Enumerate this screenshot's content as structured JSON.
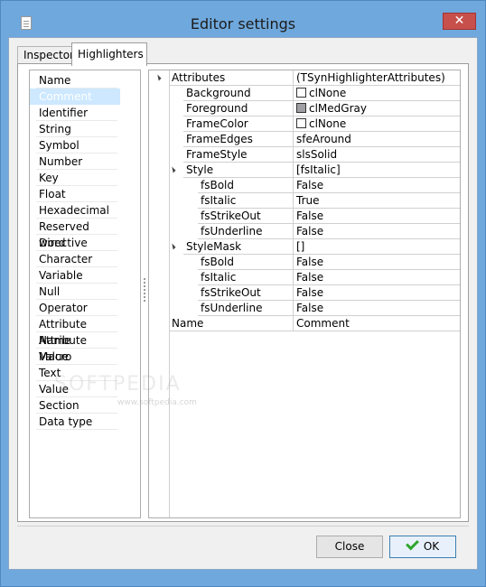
{
  "window": {
    "title": "Editor settings",
    "close_glyph": "✕"
  },
  "tabs": [
    {
      "label": "Inspector",
      "active": false
    },
    {
      "label": "Highlighters",
      "active": true
    }
  ],
  "highlighters": [
    "Name",
    "Comment",
    "Identifier",
    "String",
    "Symbol",
    "Number",
    "Key",
    "Float",
    "Hexadecimal",
    "Reserved word",
    "Directive",
    "Character",
    "Variable",
    "Null",
    "Operator",
    "Attribute Name",
    "Attribute Value",
    "Macro",
    "Text",
    "Value",
    "Section",
    "Data type"
  ],
  "selected_highlighter": "Comment",
  "properties": [
    {
      "name": "Attributes",
      "value": "(TSynHighlighterAttributes)",
      "level": 0,
      "expanded": true
    },
    {
      "name": "Background",
      "value": "clNone",
      "level": 1,
      "swatch": "#ffffff"
    },
    {
      "name": "Foreground",
      "value": "clMedGray",
      "level": 1,
      "swatch": "#a0a0a4"
    },
    {
      "name": "FrameColor",
      "value": "clNone",
      "level": 1,
      "swatch": "#ffffff"
    },
    {
      "name": "FrameEdges",
      "value": "sfeAround",
      "level": 1
    },
    {
      "name": "FrameStyle",
      "value": "slsSolid",
      "level": 1
    },
    {
      "name": "Style",
      "value": "[fsItalic]",
      "level": 1,
      "expanded": true
    },
    {
      "name": "fsBold",
      "value": "False",
      "level": 2
    },
    {
      "name": "fsItalic",
      "value": "True",
      "level": 2
    },
    {
      "name": "fsStrikeOut",
      "value": "False",
      "level": 2
    },
    {
      "name": "fsUnderline",
      "value": "False",
      "level": 2
    },
    {
      "name": "StyleMask",
      "value": "[]",
      "level": 1,
      "expanded": true
    },
    {
      "name": "fsBold",
      "value": "False",
      "level": 2
    },
    {
      "name": "fsItalic",
      "value": "False",
      "level": 2
    },
    {
      "name": "fsStrikeOut",
      "value": "False",
      "level": 2
    },
    {
      "name": "fsUnderline",
      "value": "False",
      "level": 2
    },
    {
      "name": "Name",
      "value": "Comment",
      "level": 0
    }
  ],
  "watermark": "SOFTPEDIA",
  "watermark_url": "www.softpedia.com",
  "buttons": {
    "close": "Close",
    "ok": "OK"
  },
  "colors": {
    "titlebar": "#6fa8dc",
    "selection": "#cde8ff",
    "close_button": "#c7504c"
  }
}
